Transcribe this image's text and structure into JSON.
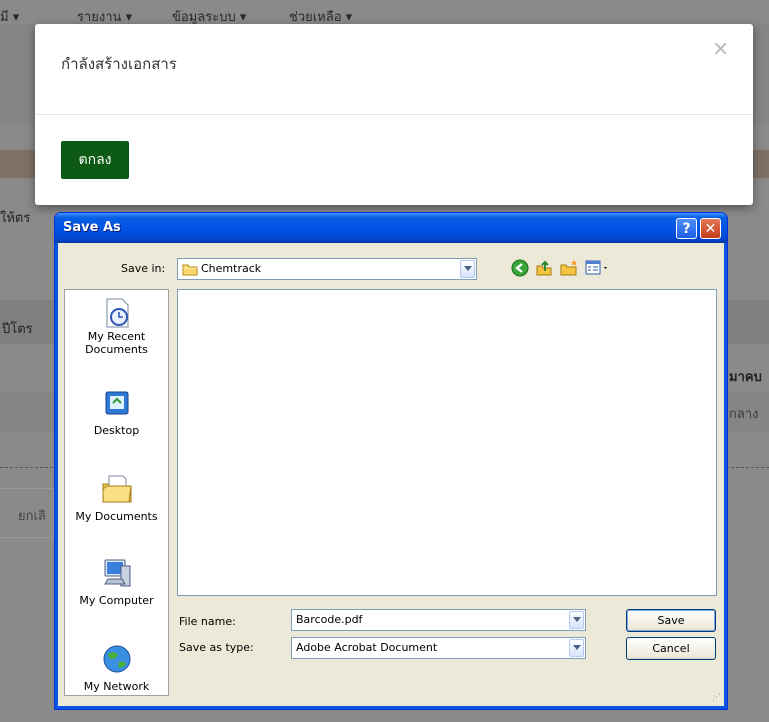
{
  "background": {
    "nav_items": [
      "มี ▾",
      "รายงาน ▾",
      "ข้อมูลระบบ ▾",
      "ช่วยเหลือ ▾"
    ],
    "fragment_left_1": "ให้ตร",
    "fragment_left_2": "ปีโตร",
    "fragment_left_3": "ยกเลิ",
    "fragment_right_1": "มาคบ",
    "fragment_right_2": "กลาง"
  },
  "modal": {
    "title": "กำลังสร้างเอกสาร",
    "close": "×",
    "ok_label": "ตกลง"
  },
  "dialog": {
    "title": "Save As",
    "help": "?",
    "close": "✕",
    "save_in_label": "Save in:",
    "save_in_value": "Chemtrack",
    "places": [
      {
        "label": "My Recent Documents",
        "icon": "recent-documents-icon"
      },
      {
        "label": "Desktop",
        "icon": "desktop-icon"
      },
      {
        "label": "My Documents",
        "icon": "my-documents-icon"
      },
      {
        "label": "My Computer",
        "icon": "my-computer-icon"
      },
      {
        "label": "My Network",
        "icon": "my-network-icon"
      }
    ],
    "file_name_label": "File name:",
    "file_name_value": "Barcode.pdf",
    "save_type_label": "Save as type:",
    "save_type_value": "Adobe Acrobat Document",
    "save_button": "Save",
    "cancel_button": "Cancel"
  }
}
